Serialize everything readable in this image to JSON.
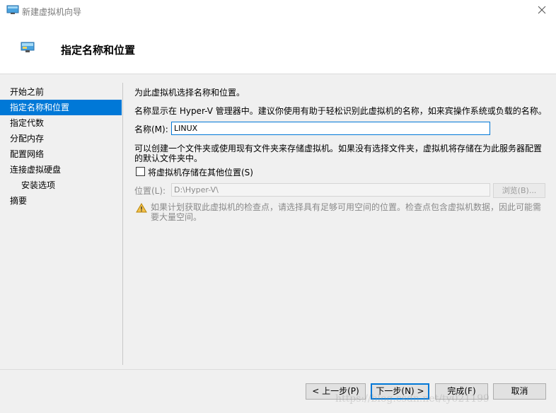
{
  "window": {
    "title": "新建虚拟机向导",
    "icon": "monitor-icon",
    "close_icon": "close-icon"
  },
  "header": {
    "title": "指定名称和位置",
    "icon": "monitor-icon"
  },
  "nav": {
    "items": [
      {
        "label": "开始之前"
      },
      {
        "label": "指定名称和位置"
      },
      {
        "label": "指定代数"
      },
      {
        "label": "分配内存"
      },
      {
        "label": "配置网络"
      },
      {
        "label": "连接虚拟硬盘"
      },
      {
        "label": "安装选项"
      },
      {
        "label": "摘要"
      }
    ],
    "active_index": 1
  },
  "content": {
    "intro": "为此虚拟机选择名称和位置。",
    "description": "名称显示在 Hyper-V 管理器中。建议你使用有助于轻松识别此虚拟机的名称，如来宾操作系统或负载的名称。",
    "name_label": "名称(M):",
    "name_value": "LINUX",
    "folder_info_line1": "可以创建一个文件夹或使用现有文件夹来存储虚拟机。如果没有选择文件夹，虚拟机将存储在为此服务器配置",
    "folder_info_line2": "的默认文件夹中。",
    "checkbox_label": "将虚拟机存储在其他位置(S)",
    "checkbox_checked": false,
    "location_label": "位置(L):",
    "location_value": "D:\\Hyper-V\\",
    "browse_label": "浏览(B)...",
    "warning_icon": "warning-icon",
    "warning_line1": "如果计划获取此虚拟机的检查点，请选择具有足够可用空间的位置。检查点包含虚拟机数据，因此可能需",
    "warning_line2": "要大量空间。"
  },
  "buttons": {
    "prev": "< 上一步(P)",
    "next": "下一步(N) >",
    "finish": "完成(F)",
    "cancel": "取消"
  },
  "watermark": "https://blog.csdn.net/ty021199",
  "colors": {
    "accent": "#0078d7",
    "panel": "#f0f0f0",
    "disabled_text": "#8a8a8a"
  }
}
